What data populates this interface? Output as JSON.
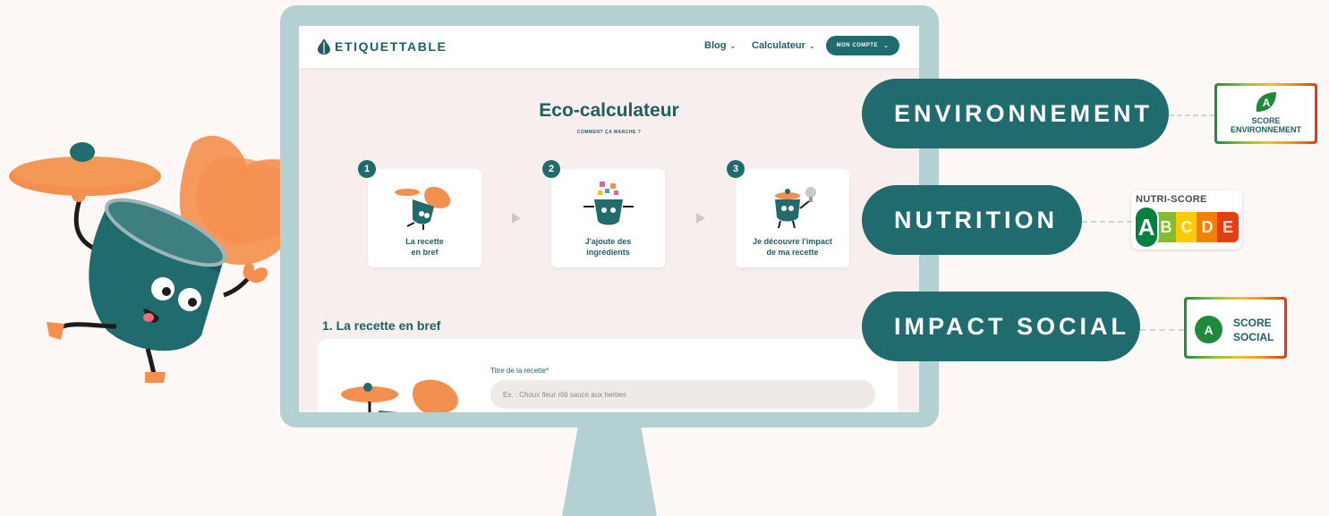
{
  "app": {
    "brand": "ETIQUETTABLE",
    "nav": {
      "blog_label": "Blog",
      "calculator_label": "Calculateur",
      "account_label": "MON COMPTE"
    }
  },
  "main": {
    "title": "Eco-calculateur",
    "subtitle": "COMMENT ÇA MARCHE ?",
    "steps": [
      {
        "number": "1",
        "label_line1": "La recette",
        "label_line2": "en bref"
      },
      {
        "number": "2",
        "label_line1": "J'ajoute des",
        "label_line2": "ingrédients"
      },
      {
        "number": "3",
        "label_line1": "Je découvre l'impact",
        "label_line2": "de ma recette"
      }
    ],
    "section_title": "1. La recette en bref",
    "form": {
      "recipe_title_label": "Titre de la recette*",
      "recipe_title_placeholder": "Ex. : Choux fleur rôti sauce aux herbes"
    }
  },
  "pills": {
    "environment": "ENVIRONNEMENT",
    "nutrition": "NUTRITION",
    "social": "IMPACT SOCIAL"
  },
  "badges": {
    "env_grade": "A",
    "env_line1": "SCORE",
    "env_line2": "ENVIRONNEMENT",
    "nutri_title": "NUTRI-SCORE",
    "nutri_grades": [
      "A",
      "B",
      "C",
      "D",
      "E"
    ],
    "nutri_selected": "A",
    "social_grade": "A",
    "social_line1": "SCORE",
    "social_line2": "SOCIAL"
  },
  "colors": {
    "brand_teal": "#1f6b6e",
    "background": "#fdf7f5",
    "accent_orange": "#f4904f",
    "nutri_A": "#038141",
    "nutri_B": "#85bb2f",
    "nutri_C": "#fecb02",
    "nutri_D": "#ee8100",
    "nutri_E": "#e63e11"
  },
  "icons": {
    "logo": "leaf-drop-icon",
    "mascot": "cooking-pot-mascot",
    "step_arrow": "play-arrow-icon"
  }
}
